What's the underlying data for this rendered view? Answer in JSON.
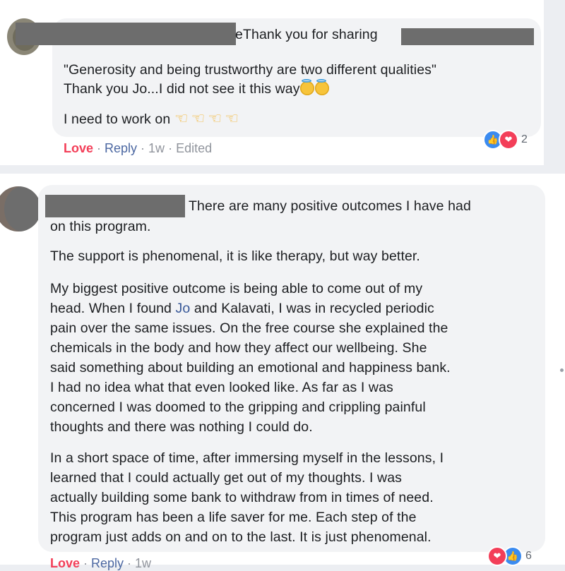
{
  "comment1": {
    "header_text": "Thank you for sharing",
    "name_tail": "e",
    "quote_line": "\"Generosity and being trustworthy are two different qualities\"",
    "line2": "Thank you Jo...I did not see it this way",
    "line3": "I need to work on",
    "actions": {
      "love": "Love",
      "sep1": " · ",
      "reply": "Reply",
      "sep2": " · ",
      "time": "1w",
      "sep3": " · ",
      "edited": "Edited"
    },
    "reaction_count": "2"
  },
  "comment2": {
    "first_line": "There are many positive outcomes I have had",
    "first_line_cont": "on this program.",
    "para2": "The support is phenomenal, it is like therapy, but way better.",
    "para3": {
      "l1": "My biggest positive outcome is being able to come out of my",
      "l2_pre": "head. When I found ",
      "l2_link": "Jo",
      "l2_post": " and Kalavati, I was in recycled periodic",
      "l3": "pain over the same issues. On the free course she explained the",
      "l4": "chemicals in the body and how they affect our wellbeing. She",
      "l5": "said something about building an emotional and happiness bank.",
      "l6": "I had no idea what that even looked like. As far as I was",
      "l7": "concerned I was doomed to the gripping and crippling painful",
      "l8": "thoughts and there was nothing I could do."
    },
    "para4": {
      "l1": "In a short space of time, after immersing myself in the lessons, I",
      "l2": "learned that I could actually get out of my thoughts. I was",
      "l3": "actually building some bank to withdraw from in times of need.",
      "l4": "This program has been a life saver for me. Each step of the",
      "l5": "program just adds on and on to the last. It is just phenomenal."
    },
    "actions": {
      "love": "Love",
      "sep1": " · ",
      "reply": "Reply",
      "sep2": " · ",
      "time": "1w"
    },
    "reaction_count": "6"
  },
  "icons": {
    "like": "thumbs-up-icon",
    "love": "heart-icon",
    "angel": "smiling-face-with-halo-emoji",
    "hand": "backhand-index-pointing-right-emoji"
  },
  "colors": {
    "love_text": "#f33e58",
    "reply_link": "#4b67a1",
    "mention_link": "#385898",
    "bubble_bg": "#f2f3f5",
    "redaction": "#6d6d6d",
    "like_blue": "#3b8bf0"
  }
}
